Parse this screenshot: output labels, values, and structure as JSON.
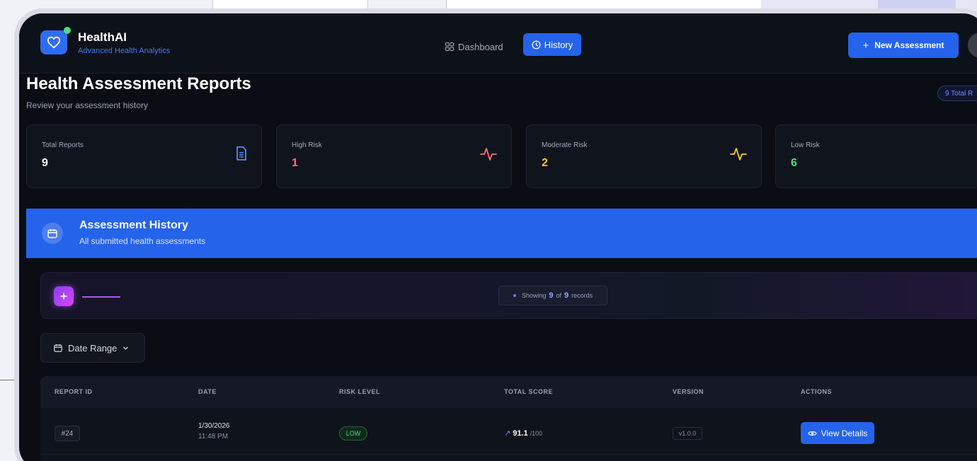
{
  "app": {
    "name": "HealthAI",
    "tagline": "Advanced Health Analytics"
  },
  "nav": {
    "dashboard": "Dashboard",
    "history": "History",
    "active": "history"
  },
  "header_actions": {
    "new_assessment": "New Assessment"
  },
  "page": {
    "title": "Health Assessment Reports",
    "subtitle": "Review your assessment history",
    "total_badge": "9 Total R"
  },
  "stats": [
    {
      "label": "Total Reports",
      "value": "9",
      "color": "#ffffff",
      "icon": "document-icon"
    },
    {
      "label": "High Risk",
      "value": "1",
      "color": "#f87171",
      "icon": "activity-icon"
    },
    {
      "label": "Moderate Risk",
      "value": "2",
      "color": "#facc15",
      "icon": "activity-icon"
    },
    {
      "label": "Low Risk",
      "value": "6",
      "color": "#4ade80",
      "icon": "activity-icon"
    }
  ],
  "history": {
    "title": "Assessment History",
    "subtitle": "All submitted health assessments"
  },
  "filter": {
    "showing_prefix": "Showing",
    "shown": "9",
    "of": "of",
    "total": "9",
    "suffix": "records",
    "date_range": "Date Range"
  },
  "table": {
    "columns": [
      "REPORT ID",
      "DATE",
      "RISK LEVEL",
      "TOTAL SCORE",
      "VERSION",
      "ACTIONS"
    ],
    "rows": [
      {
        "id": "#24",
        "date": "1/30/2026",
        "time": "11:48 PM",
        "risk": "LOW",
        "score": "91.1",
        "score_max": "/100",
        "version": "v1.0.0",
        "action": "View Details"
      }
    ]
  },
  "colors": {
    "accent": "#2563eb",
    "high": "#f87171",
    "moderate": "#facc15",
    "low": "#4ade80"
  }
}
